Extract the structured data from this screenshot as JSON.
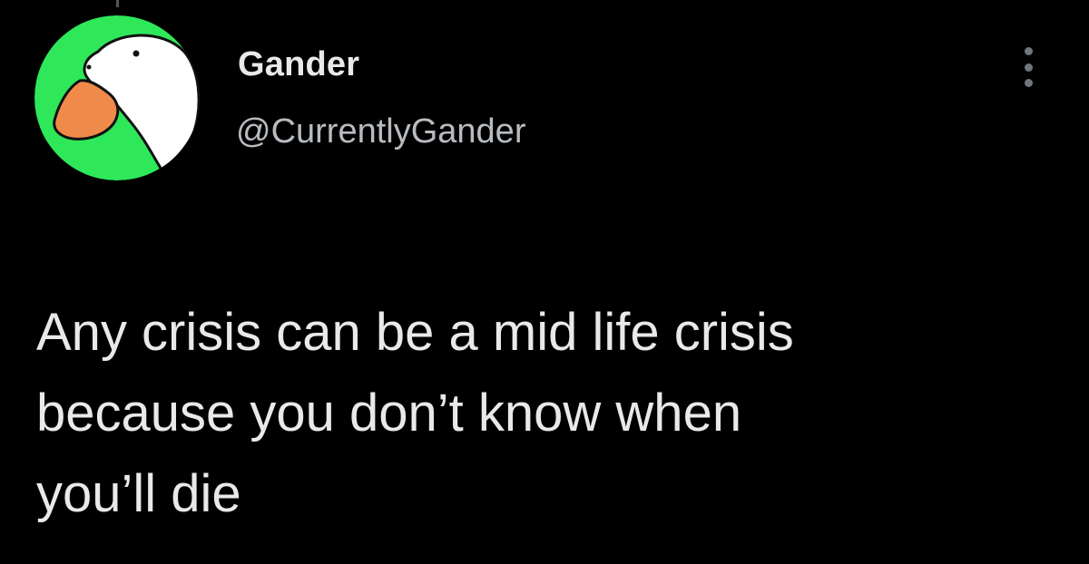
{
  "tweet": {
    "display_name": "Gander",
    "handle": "@CurrentlyGander",
    "text_lines": [
      "Any crisis can be a mid life crisis",
      "because you don’t know when",
      "you’ll die"
    ]
  },
  "avatar": {
    "icon": "goose-icon",
    "background_color": "#2ee85a",
    "head_color": "#ffffff",
    "beak_color": "#f08a4b"
  },
  "more": {
    "icon": "more-options-icon"
  },
  "colors": {
    "background": "#000000",
    "primary_text": "#e7e9ea",
    "secondary_text": "#b8bcc0"
  }
}
